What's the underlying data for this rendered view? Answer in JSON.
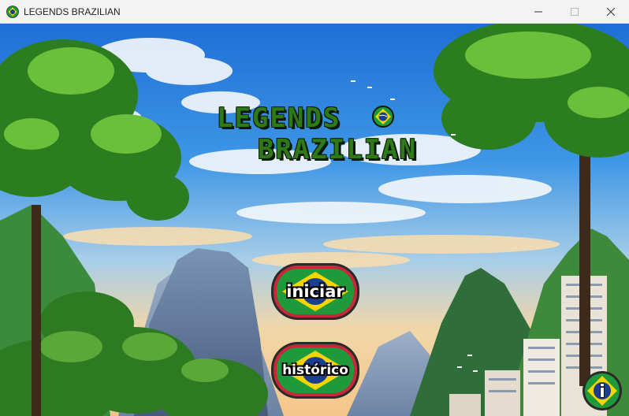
{
  "window": {
    "title": "LEGENDS BRAZILIAN",
    "icon": "brazil-flag-icon",
    "controls": [
      "minimize-icon",
      "maximize-icon",
      "close-icon"
    ]
  },
  "game": {
    "title_line1": "LEGENDS",
    "title_line2": "BRAZILIAN",
    "title_icon": "brazil-flag-icon"
  },
  "menu": {
    "start_label": "iniciar",
    "history_label": "histórico",
    "info_label": "i"
  },
  "colors": {
    "flag_green": "#1f9a3a",
    "flag_yellow": "#f5d400",
    "flag_blue": "#1b3f8f",
    "title_green": "#2f7a18",
    "button_border": "#c9283a"
  }
}
